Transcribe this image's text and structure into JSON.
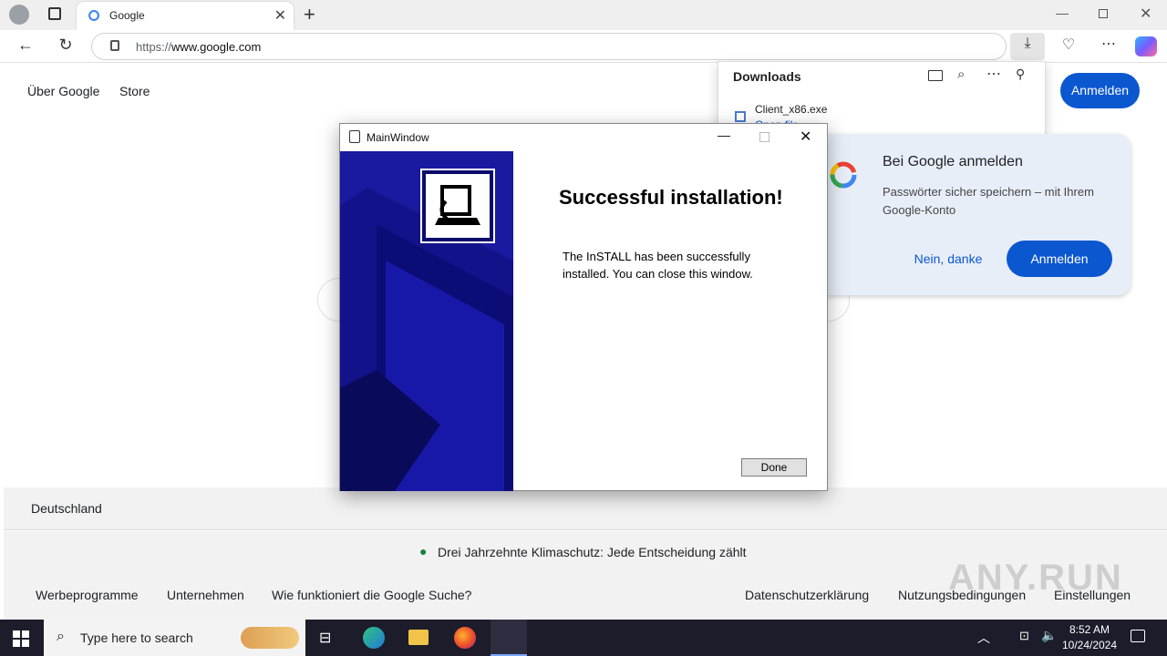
{
  "browser": {
    "tab_title": "Google",
    "url_prefix": "https://",
    "url_host": "www.google.com"
  },
  "google": {
    "about": "Über Google",
    "store": "Store",
    "signin": "Anmelden",
    "country": "Deutschland",
    "climate": "Drei Jahrzehnte Klimaschutz: Jede Entscheidung zählt",
    "footer_left": [
      "Werbeprogramme",
      "Unternehmen",
      "Wie funktioniert die Google Suche?"
    ],
    "footer_right": [
      "Datenschutzerklärung",
      "Nutzungsbedingungen",
      "Einstellungen"
    ]
  },
  "downloads": {
    "title": "Downloads",
    "file_name": "Client_x86.exe",
    "file_action": "Open file"
  },
  "popup": {
    "heading": "Bei Google anmelden",
    "body": "Passwörter sicher speichern – mit Ihrem Google-Konto",
    "decline": "Nein, danke",
    "accept": "Anmelden"
  },
  "installer": {
    "window_title": "MainWindow",
    "heading": "Successful installation!",
    "message": "The InSTALL has been successfully installed. You can close this window.",
    "done": "Done"
  },
  "taskbar": {
    "search_placeholder": "Type here to search",
    "time": "8:52 AM",
    "date": "10/24/2024"
  },
  "watermark": "ANY.RUN",
  "colors": {
    "accent": "#0b57d0",
    "installer_side": "#0a0a6e"
  }
}
